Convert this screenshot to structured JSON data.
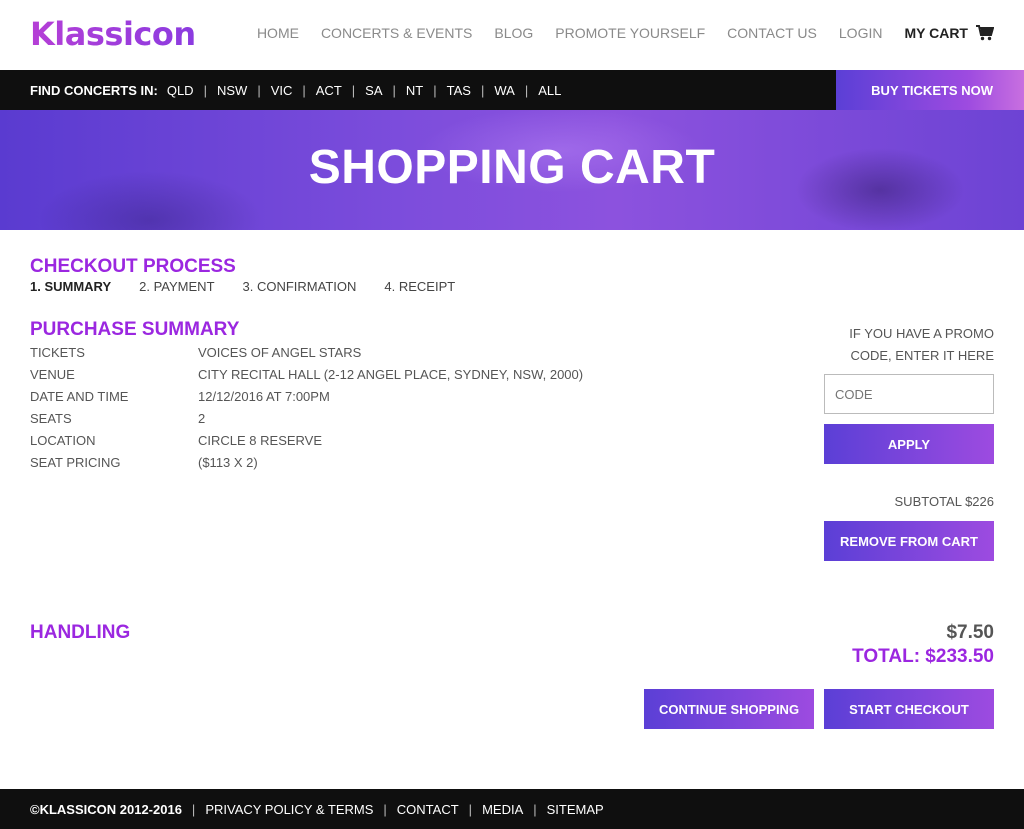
{
  "brand": {
    "logo_text": "Klassicon"
  },
  "nav": {
    "items": [
      "HOME",
      "CONCERTS & EVENTS",
      "BLOG",
      "PROMOTE YOURSELF",
      "CONTACT US",
      "LOGIN"
    ],
    "cart_label": "MY CART"
  },
  "regions": {
    "label": "FIND CONCERTS IN:",
    "items": [
      "QLD",
      "NSW",
      "VIC",
      "ACT",
      "SA",
      "NT",
      "TAS",
      "WA",
      "ALL"
    ],
    "buy_label": "BUY TICKETS NOW"
  },
  "hero": {
    "title": "SHOPPING CART"
  },
  "checkout": {
    "title": "CHECKOUT PROCESS",
    "steps": [
      "1. SUMMARY",
      "2. PAYMENT",
      "3. CONFIRMATION",
      "4. RECEIPT"
    ]
  },
  "summary": {
    "title": "PURCHASE SUMMARY",
    "rows": [
      {
        "label": "TICKETS",
        "value": "VOICES OF ANGEL STARS"
      },
      {
        "label": "VENUE",
        "value": "CITY RECITAL HALL (2-12 ANGEL PLACE, SYDNEY, NSW, 2000)"
      },
      {
        "label": "DATE AND TIME",
        "value": "12/12/2016 AT 7:00PM"
      },
      {
        "label": "SEATS",
        "value": "2"
      },
      {
        "label": "LOCATION",
        "value": "CIRCLE 8 RESERVE"
      },
      {
        "label": "SEAT PRICING",
        "value": "($113 X 2)"
      }
    ]
  },
  "promo": {
    "line1": "IF YOU HAVE A PROMO",
    "line2": "CODE, ENTER IT HERE",
    "placeholder": "CODE",
    "apply_label": "APPLY"
  },
  "subtotal": "SUBTOTAL $226",
  "remove_label": "REMOVE FROM CART",
  "handling": {
    "label": "HANDLING",
    "amount": "$7.50"
  },
  "total": "TOTAL: $233.50",
  "actions": {
    "continue_label": "CONTINUE SHOPPING",
    "checkout_label": "START CHECKOUT"
  },
  "footer": {
    "copyright": "©KLASSICON 2012-2016",
    "links": [
      "PRIVACY POLICY & TERMS",
      "CONTACT",
      "MEDIA",
      "SITEMAP"
    ]
  },
  "colors": {
    "accent": "#9b27e0",
    "button_start": "#5b3fd6",
    "button_end": "#9d4be0",
    "bar": "#0f0f0f"
  }
}
